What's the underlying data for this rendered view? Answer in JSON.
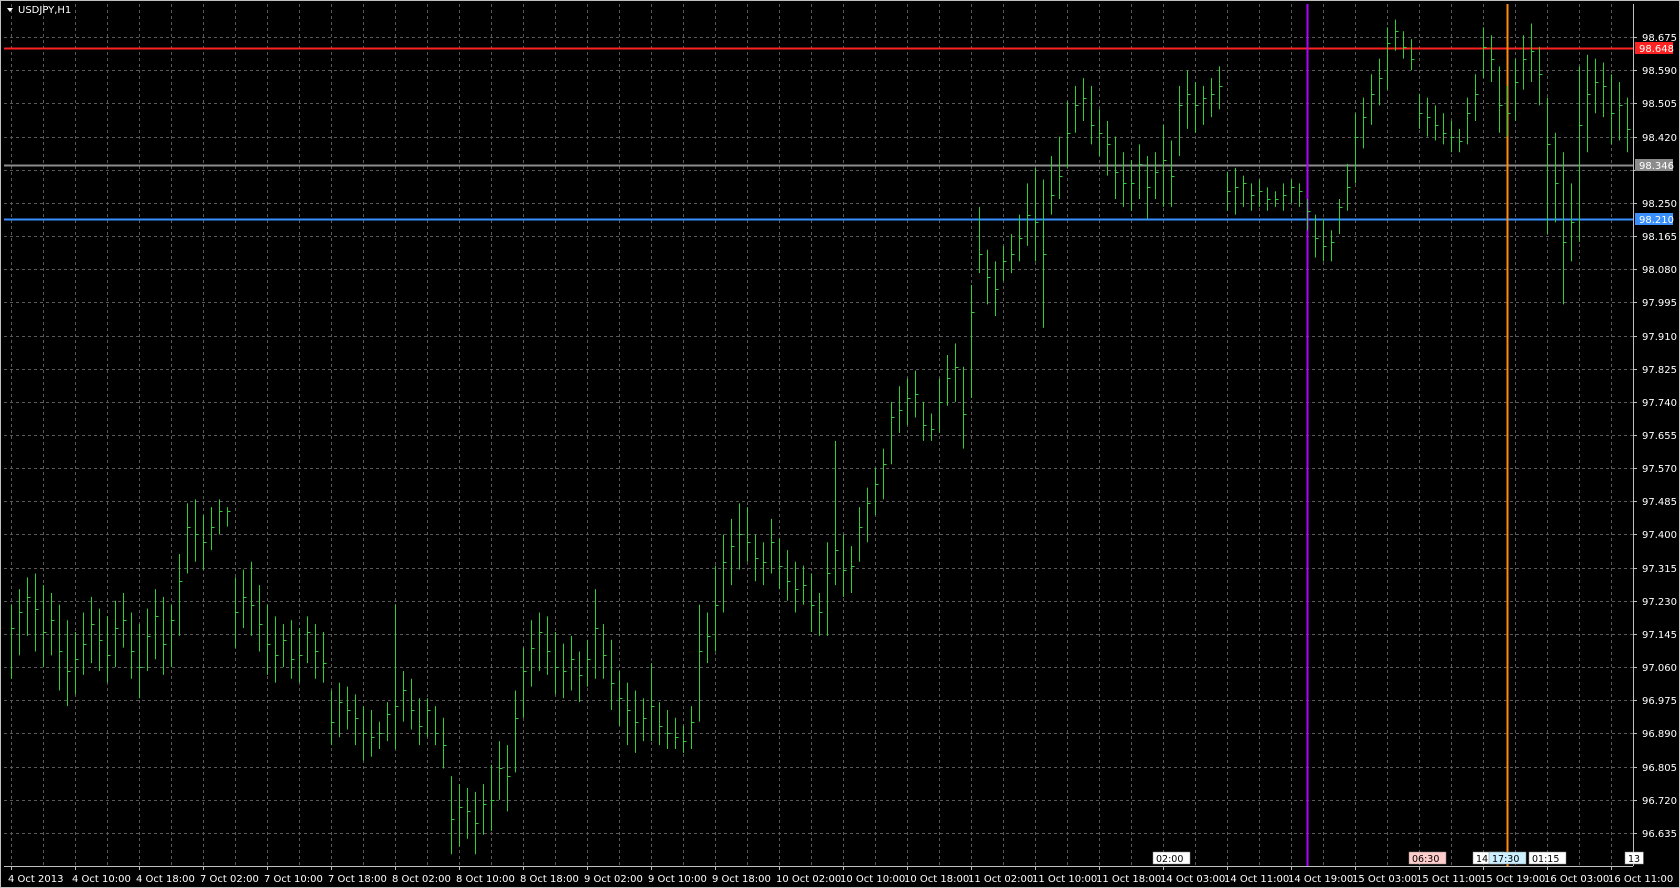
{
  "window": {
    "title": "USDJPY,H1",
    "menu_icon": "triangle-down-icon"
  },
  "colors": {
    "background": "#000000",
    "frame": "#c0c0c0",
    "grid": "#5a5a5a",
    "bar": "#2fd12f",
    "axis_text": "#ffffff",
    "red_line": "#ff2222",
    "blue_line": "#3a8fff",
    "gray_line": "#8c8c8c",
    "purple_line": "#b000ff",
    "orange_line": "#ff8c10"
  },
  "chart_data": {
    "type": "ohlc_bar",
    "symbol": "USDJPY",
    "timeframe": "H1",
    "ylim": [
      96.55,
      98.76
    ],
    "y_ticks": [
      98.675,
      98.59,
      98.505,
      98.42,
      98.335,
      98.25,
      98.165,
      98.08,
      97.995,
      97.91,
      97.825,
      97.74,
      97.655,
      97.57,
      97.485,
      97.4,
      97.315,
      97.23,
      97.145,
      97.06,
      96.975,
      96.89,
      96.805,
      96.72,
      96.635
    ],
    "y_tick_labels": [
      "98.675",
      "98.590",
      "98.505",
      "98.420",
      "",
      "98.250",
      "98.165",
      "98.080",
      "97.995",
      "97.910",
      "97.825",
      "97.740",
      "97.655",
      "97.570",
      "97.485",
      "97.400",
      "97.315",
      "97.230",
      "97.145",
      "97.060",
      "96.975",
      "96.890",
      "96.805",
      "96.720",
      "96.635"
    ],
    "x_labels": [
      "4 Oct 2013",
      "4 Oct 10:00",
      "4 Oct 18:00",
      "7 Oct 02:00",
      "7 Oct 10:00",
      "7 Oct 18:00",
      "8 Oct 02:00",
      "8 Oct 10:00",
      "8 Oct 18:00",
      "9 Oct 02:00",
      "9 Oct 10:00",
      "9 Oct 18:00",
      "10 Oct 02:00",
      "10 Oct 10:00",
      "10 Oct 18:00",
      "11 Oct 02:00",
      "11 Oct 10:00",
      "11 Oct 18:00",
      "14 Oct 03:00",
      "14 Oct 11:00",
      "14 Oct 19:00",
      "15 Oct 03:00",
      "15 Oct 11:00",
      "15 Oct 19:00",
      "16 Oct 03:00",
      "16 Oct 11:00"
    ],
    "bars_per_label": 8,
    "bars": [
      [
        97.22,
        97.03,
        97.16
      ],
      [
        97.26,
        97.09,
        97.2
      ],
      [
        97.29,
        97.14,
        97.24
      ],
      [
        97.3,
        97.1,
        97.21
      ],
      [
        97.27,
        97.06,
        97.15
      ],
      [
        97.25,
        97.09,
        97.18
      ],
      [
        97.22,
        97.0,
        97.1
      ],
      [
        97.18,
        96.96,
        97.05
      ],
      [
        97.15,
        96.99,
        97.08
      ],
      [
        97.2,
        97.04,
        97.12
      ],
      [
        97.24,
        97.07,
        97.17
      ],
      [
        97.21,
        97.05,
        97.13
      ],
      [
        97.19,
        97.02,
        97.09
      ],
      [
        97.23,
        97.06,
        97.16
      ],
      [
        97.25,
        97.11,
        97.18
      ],
      [
        97.2,
        97.03,
        97.1
      ],
      [
        97.17,
        96.98,
        97.06
      ],
      [
        97.21,
        97.05,
        97.14
      ],
      [
        97.26,
        97.08,
        97.19
      ],
      [
        97.24,
        97.04,
        97.12
      ],
      [
        97.22,
        97.06,
        97.18
      ],
      [
        97.35,
        97.14,
        97.28
      ],
      [
        97.48,
        97.3,
        97.42
      ],
      [
        97.49,
        97.33,
        97.4
      ],
      [
        97.45,
        97.31,
        97.38
      ],
      [
        97.47,
        97.36,
        97.42
      ],
      [
        97.49,
        97.4,
        97.46
      ],
      [
        97.47,
        97.42,
        97.46
      ],
      [
        97.29,
        97.11,
        97.2
      ],
      [
        97.31,
        97.16,
        97.24
      ],
      [
        97.33,
        97.14,
        97.22
      ],
      [
        97.27,
        97.1,
        97.17
      ],
      [
        97.22,
        97.04,
        97.12
      ],
      [
        97.19,
        97.02,
        97.09
      ],
      [
        97.17,
        97.06,
        97.13
      ],
      [
        97.18,
        97.03,
        97.08
      ],
      [
        97.16,
        97.02,
        97.09
      ],
      [
        97.19,
        97.07,
        97.15
      ],
      [
        97.17,
        97.03,
        97.1
      ],
      [
        97.15,
        97.02,
        97.07
      ],
      [
        97.0,
        96.86,
        96.92
      ],
      [
        97.02,
        96.88,
        96.97
      ],
      [
        97.01,
        96.9,
        96.95
      ],
      [
        96.99,
        96.86,
        96.93
      ],
      [
        96.96,
        96.82,
        96.89
      ],
      [
        96.95,
        96.83,
        96.88
      ],
      [
        96.92,
        96.85,
        96.89
      ],
      [
        96.97,
        96.87,
        96.94
      ],
      [
        97.22,
        96.85,
        96.96
      ],
      [
        97.05,
        96.92,
        97.0
      ],
      [
        97.03,
        96.9,
        96.95
      ],
      [
        96.98,
        96.86,
        96.91
      ],
      [
        96.98,
        96.88,
        96.95
      ],
      [
        96.96,
        96.86,
        96.89
      ],
      [
        96.93,
        96.8,
        96.86
      ],
      [
        96.78,
        96.58,
        96.67
      ],
      [
        96.76,
        96.6,
        96.7
      ],
      [
        96.75,
        96.62,
        96.69
      ],
      [
        96.74,
        96.58,
        96.66
      ],
      [
        96.76,
        96.63,
        96.71
      ],
      [
        96.81,
        96.64,
        96.72
      ],
      [
        96.87,
        96.72,
        96.8
      ],
      [
        96.86,
        96.69,
        96.78
      ],
      [
        97.0,
        96.79,
        96.93
      ],
      [
        97.11,
        96.93,
        97.05
      ],
      [
        97.18,
        97.01,
        97.11
      ],
      [
        97.2,
        97.05,
        97.15
      ],
      [
        97.19,
        97.04,
        97.1
      ],
      [
        97.15,
        96.99,
        97.06
      ],
      [
        97.12,
        96.98,
        97.05
      ],
      [
        97.14,
        97.0,
        97.08
      ],
      [
        97.1,
        96.97,
        97.04
      ],
      [
        97.13,
        97.01,
        97.08
      ],
      [
        97.26,
        97.03,
        97.16
      ],
      [
        97.17,
        97.03,
        97.09
      ],
      [
        97.13,
        96.95,
        97.02
      ],
      [
        97.05,
        96.91,
        96.98
      ],
      [
        97.02,
        96.86,
        96.95
      ],
      [
        97.0,
        96.84,
        96.92
      ],
      [
        96.98,
        96.87,
        96.93
      ],
      [
        97.07,
        96.87,
        96.96
      ],
      [
        96.97,
        96.86,
        96.91
      ],
      [
        96.95,
        96.85,
        96.89
      ],
      [
        96.93,
        96.85,
        96.88
      ],
      [
        96.91,
        96.84,
        96.87
      ],
      [
        96.96,
        96.85,
        96.92
      ],
      [
        97.22,
        96.92,
        97.1
      ],
      [
        97.2,
        97.07,
        97.14
      ],
      [
        97.32,
        97.1,
        97.22
      ],
      [
        97.4,
        97.2,
        97.33
      ],
      [
        97.44,
        97.27,
        97.37
      ],
      [
        97.48,
        97.31,
        97.4
      ],
      [
        97.47,
        97.33,
        97.38
      ],
      [
        97.4,
        97.28,
        97.34
      ],
      [
        97.38,
        97.27,
        97.33
      ],
      [
        97.44,
        97.3,
        97.38
      ],
      [
        97.39,
        97.26,
        97.32
      ],
      [
        97.36,
        97.23,
        97.28
      ],
      [
        97.33,
        97.2,
        97.26
      ],
      [
        97.32,
        97.22,
        97.27
      ],
      [
        97.3,
        97.15,
        97.22
      ],
      [
        97.25,
        97.14,
        97.2
      ],
      [
        97.38,
        97.14,
        97.3
      ],
      [
        97.64,
        97.27,
        97.36
      ],
      [
        97.4,
        97.24,
        97.31
      ],
      [
        97.37,
        97.25,
        97.32
      ],
      [
        97.47,
        97.33,
        97.42
      ],
      [
        97.52,
        97.38,
        97.48
      ],
      [
        97.57,
        97.45,
        97.53
      ],
      [
        97.62,
        97.49,
        97.58
      ],
      [
        97.74,
        97.58,
        97.7
      ],
      [
        97.78,
        97.66,
        97.72
      ],
      [
        97.8,
        97.68,
        97.75
      ],
      [
        97.82,
        97.7,
        97.76
      ],
      [
        97.74,
        97.64,
        97.68
      ],
      [
        97.71,
        97.64,
        97.67
      ],
      [
        97.8,
        97.66,
        97.74
      ],
      [
        97.86,
        97.73,
        97.8
      ],
      [
        97.89,
        97.74,
        97.83
      ],
      [
        97.83,
        97.62,
        97.71
      ],
      [
        98.04,
        97.75,
        97.97
      ],
      [
        98.24,
        98.07,
        98.12
      ],
      [
        98.13,
        97.99,
        98.06
      ],
      [
        98.1,
        97.96,
        98.03
      ],
      [
        98.14,
        98.05,
        98.1
      ],
      [
        98.17,
        98.07,
        98.12
      ],
      [
        98.22,
        98.1,
        98.16
      ],
      [
        98.3,
        98.14,
        98.22
      ],
      [
        98.34,
        98.1,
        98.2
      ],
      [
        98.31,
        97.93,
        98.12
      ],
      [
        98.37,
        98.22,
        98.27
      ],
      [
        98.42,
        98.26,
        98.32
      ],
      [
        98.51,
        98.34,
        98.43
      ],
      [
        98.55,
        98.43,
        98.5
      ],
      [
        98.57,
        98.46,
        98.52
      ],
      [
        98.55,
        98.4,
        98.45
      ],
      [
        98.49,
        98.37,
        98.43
      ],
      [
        98.46,
        98.32,
        98.4
      ],
      [
        98.42,
        98.26,
        98.33
      ],
      [
        98.38,
        98.24,
        98.3
      ],
      [
        98.36,
        98.23,
        98.3
      ],
      [
        98.4,
        98.26,
        98.35
      ],
      [
        98.37,
        98.21,
        98.29
      ],
      [
        98.38,
        98.26,
        98.33
      ],
      [
        98.45,
        98.24,
        98.36
      ],
      [
        98.41,
        98.24,
        98.32
      ],
      [
        98.55,
        98.37,
        98.5
      ],
      [
        98.59,
        98.44,
        98.53
      ],
      [
        98.56,
        98.43,
        98.5
      ],
      [
        98.55,
        98.45,
        98.52
      ],
      [
        98.57,
        98.47,
        98.53
      ],
      [
        98.6,
        98.49,
        98.55
      ],
      [
        98.33,
        98.23,
        98.28
      ],
      [
        98.34,
        98.22,
        98.29
      ],
      [
        98.32,
        98.24,
        98.3
      ],
      [
        98.3,
        98.23,
        98.27
      ],
      [
        98.31,
        98.24,
        98.28
      ],
      [
        98.29,
        98.23,
        98.26
      ],
      [
        98.28,
        98.24,
        98.26
      ],
      [
        98.3,
        98.23,
        98.27
      ],
      [
        98.31,
        98.25,
        98.29
      ],
      [
        98.3,
        98.24,
        98.28
      ],
      [
        98.26,
        98.18,
        98.23
      ],
      [
        98.22,
        98.11,
        98.16
      ],
      [
        98.21,
        98.1,
        98.14
      ],
      [
        98.18,
        98.1,
        98.15
      ],
      [
        98.26,
        98.17,
        98.24
      ],
      [
        98.35,
        98.23,
        98.29
      ],
      [
        98.48,
        98.3,
        98.42
      ],
      [
        98.52,
        98.39,
        98.47
      ],
      [
        98.58,
        98.45,
        98.53
      ],
      [
        98.62,
        98.5,
        98.57
      ],
      [
        98.7,
        98.54,
        98.66
      ],
      [
        98.72,
        98.64,
        98.69
      ],
      [
        98.69,
        98.62,
        98.65
      ],
      [
        98.67,
        98.59,
        98.62
      ],
      [
        98.53,
        98.44,
        98.48
      ],
      [
        98.52,
        98.42,
        98.47
      ],
      [
        98.5,
        98.41,
        98.45
      ],
      [
        98.48,
        98.4,
        98.43
      ],
      [
        98.46,
        98.38,
        98.42
      ],
      [
        98.44,
        98.38,
        98.41
      ],
      [
        98.52,
        98.4,
        98.48
      ],
      [
        98.58,
        98.46,
        98.53
      ],
      [
        98.7,
        98.57,
        98.65
      ],
      [
        98.68,
        98.56,
        98.62
      ],
      [
        98.6,
        98.43,
        98.5
      ],
      [
        98.55,
        98.42,
        98.48
      ],
      [
        98.62,
        98.46,
        98.56
      ],
      [
        98.68,
        98.54,
        98.62
      ],
      [
        98.71,
        98.56,
        98.64
      ],
      [
        98.65,
        98.5,
        98.58
      ],
      [
        98.52,
        98.17,
        98.4
      ],
      [
        98.43,
        98.2,
        98.3
      ],
      [
        98.38,
        97.99,
        98.15
      ],
      [
        98.3,
        98.1,
        98.2
      ],
      [
        98.6,
        98.15,
        98.45
      ],
      [
        98.63,
        98.38,
        98.53
      ],
      [
        98.62,
        98.48,
        98.56
      ],
      [
        98.61,
        98.47,
        98.55
      ],
      [
        98.58,
        98.4,
        98.48
      ],
      [
        98.56,
        98.41,
        98.5
      ],
      [
        98.52,
        98.38,
        98.44
      ],
      [
        98.45,
        98.34,
        98.4
      ],
      [
        98.42,
        98.32,
        98.38
      ],
      [
        98.4,
        98.32,
        98.36
      ],
      [
        98.38,
        98.31,
        98.35
      ]
    ],
    "horizontal_lines": [
      {
        "price": 98.648,
        "label": "98.648",
        "color": "#ff2222"
      },
      {
        "price": 98.346,
        "label": "98.346",
        "color": "#8c8c8c"
      },
      {
        "price": 98.21,
        "label": "98.210",
        "color": "#3a8fff"
      }
    ],
    "vertical_lines": [
      {
        "bar_index": 162,
        "color": "#b000ff"
      },
      {
        "bar_index": 187,
        "color": "#ff8c10"
      }
    ],
    "time_markers": [
      {
        "bar_index": 143,
        "label": "02:00",
        "bg": "#ffffff"
      },
      {
        "bar_index": 175,
        "label": "06:30",
        "bg": "#ffcccc"
      },
      {
        "bar_index": 183,
        "label": "14:1",
        "bg": "#ffffff"
      },
      {
        "bar_index": 185,
        "label": "17:30",
        "bg": "#ccf0ff"
      },
      {
        "bar_index": 190,
        "label": "01:15",
        "bg": "#ffffff"
      },
      {
        "bar_index": 202,
        "label": "13",
        "bg": "#ffffff"
      }
    ]
  }
}
